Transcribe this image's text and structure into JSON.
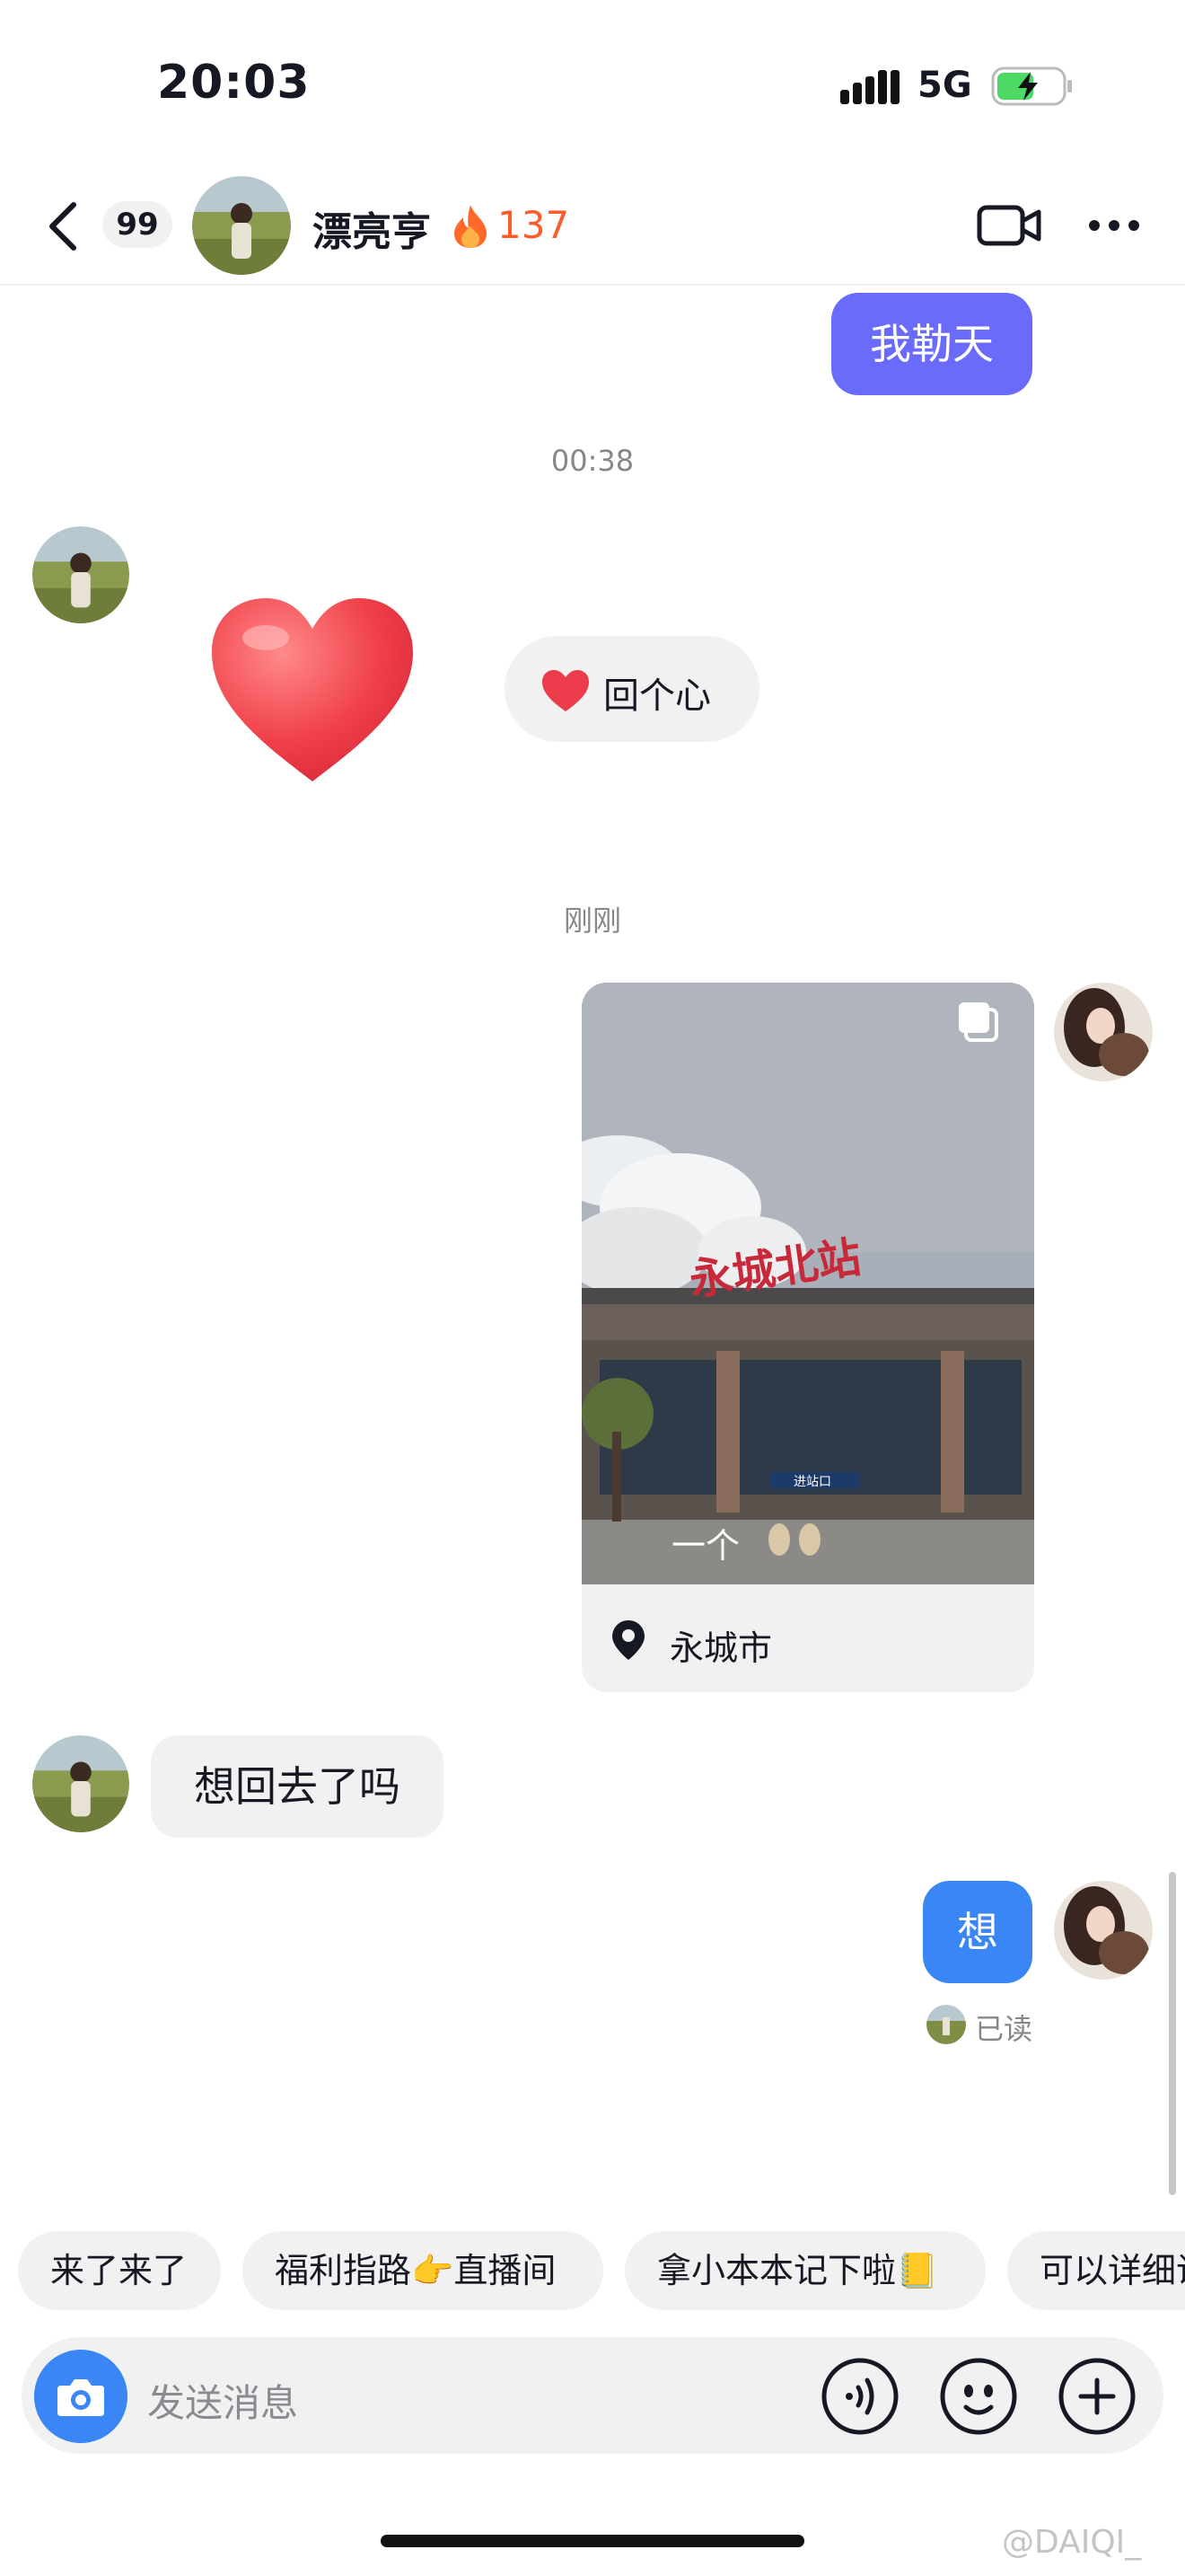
{
  "status_bar": {
    "time": "20:03",
    "network": "5G"
  },
  "header": {
    "unread_badge": "99",
    "contact_name": "漂亮亨",
    "streak_count": "137"
  },
  "messages": {
    "m1_text": "我勒天",
    "timestamp1": "00:38",
    "heart_reply_label": "回个心",
    "timestamp2": "刚刚",
    "card_location": "永城市",
    "card_sign": "永城北站",
    "card_caption": "一个",
    "card_gate": "进站口",
    "m2_text": "想回去了吗",
    "m3_text": "想",
    "read_status": "已读"
  },
  "quick_replies": [
    "来了来了",
    "福利指路👉直播间",
    "拿小本本记下啦📒",
    "可以详细说"
  ],
  "input": {
    "placeholder": "发送消息"
  },
  "watermark": "@DAIQI_",
  "colors": {
    "purple_bubble": "#6a6bfa",
    "blue_bubble": "#3a86f5",
    "streak": "#fe5b2a",
    "gray_bubble": "#f1f1f2"
  },
  "icons": [
    "back-icon",
    "flame-icon",
    "video-call-icon",
    "more-icon",
    "heart-icon",
    "location-pin-icon",
    "camera-icon",
    "voice-icon",
    "emoji-icon",
    "plus-icon",
    "multi-image-icon"
  ]
}
